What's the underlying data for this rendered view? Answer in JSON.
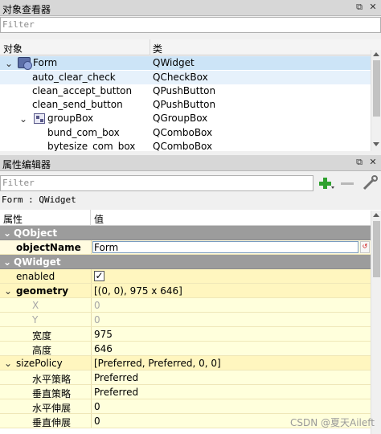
{
  "object_inspector": {
    "title": "对象查看器",
    "filter_placeholder": "Filter",
    "columns": [
      "对象",
      "类"
    ],
    "rows": [
      {
        "name": "Form",
        "class": "QWidget"
      },
      {
        "name": "auto_clear_check",
        "class": "QCheckBox"
      },
      {
        "name": "clean_accept_button",
        "class": "QPushButton"
      },
      {
        "name": "clean_send_button",
        "class": "QPushButton"
      },
      {
        "name": "groupBox",
        "class": "QGroupBox"
      },
      {
        "name": "bund_com_box",
        "class": "QComboBox"
      },
      {
        "name": "bytesize_com_box",
        "class": "QComboBox"
      }
    ]
  },
  "property_editor": {
    "title": "属性编辑器",
    "filter_placeholder": "Filter",
    "context": "Form : QWidget",
    "columns": [
      "属性",
      "值"
    ],
    "rows": [
      {
        "name": "QObject",
        "value": ""
      },
      {
        "name": "objectName",
        "value": "Form"
      },
      {
        "name": "QWidget",
        "value": ""
      },
      {
        "name": "enabled",
        "value": "✓"
      },
      {
        "name": "geometry",
        "value": "[(0, 0), 975 x 646]"
      },
      {
        "name": "X",
        "value": "0"
      },
      {
        "name": "Y",
        "value": "0"
      },
      {
        "name": "宽度",
        "value": "975"
      },
      {
        "name": "高度",
        "value": "646"
      },
      {
        "name": "sizePolicy",
        "value": "[Preferred, Preferred, 0, 0]"
      },
      {
        "name": "水平策略",
        "value": "Preferred"
      },
      {
        "name": "垂直策略",
        "value": "Preferred"
      },
      {
        "name": "水平伸展",
        "value": "0"
      },
      {
        "name": "垂直伸展",
        "value": "0"
      }
    ]
  },
  "watermark": "CSDN @夏天Aileft",
  "colors": {
    "selection": "#cce4f7",
    "group_header": "#9c9c9c",
    "prop_bg_light": "#ffffdc",
    "prop_bg_dark": "#fff6bf",
    "add_icon": "#2fa12f"
  }
}
